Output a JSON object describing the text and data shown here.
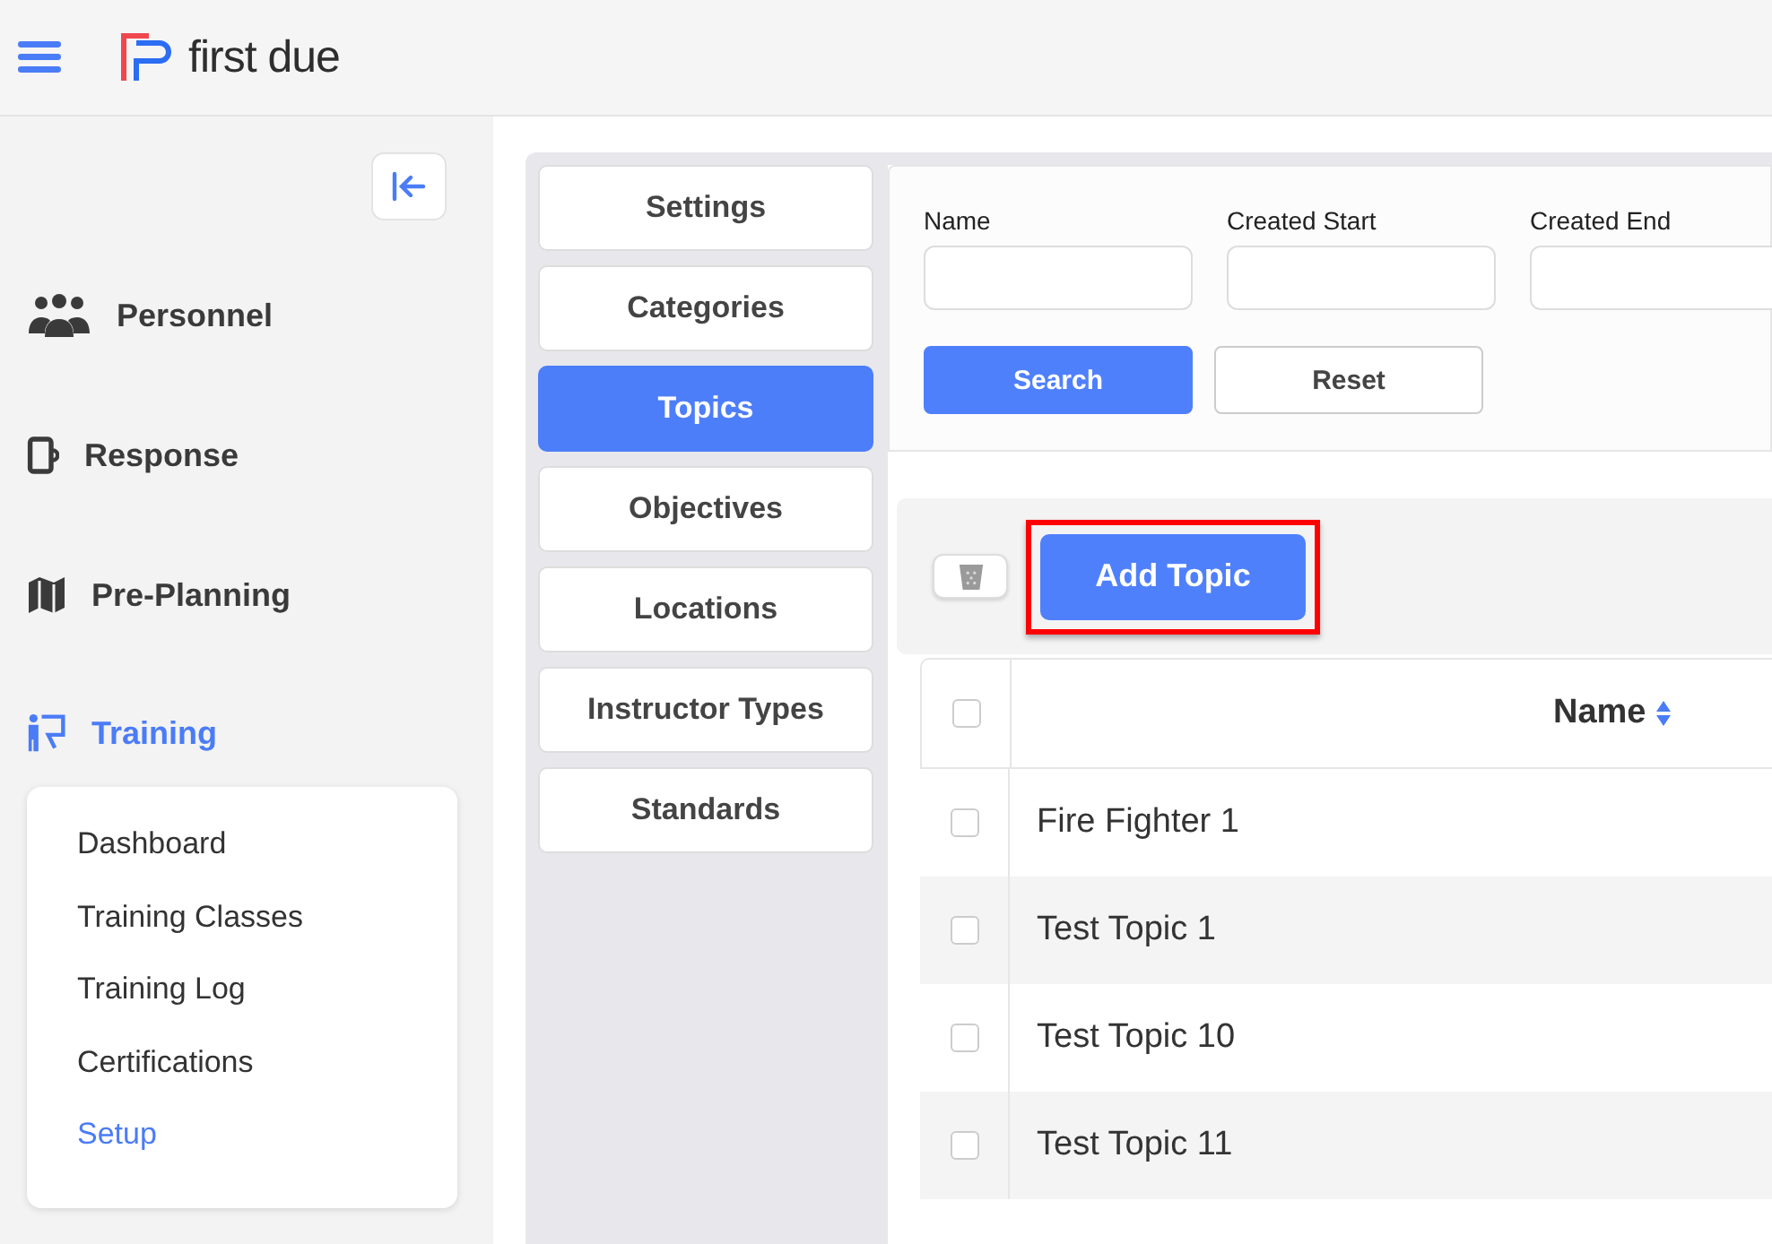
{
  "header": {
    "brand": "first due"
  },
  "sidebar": {
    "items": [
      {
        "label": "Personnel",
        "kind": "people",
        "selected": false
      },
      {
        "label": "Response",
        "kind": "device",
        "selected": false
      },
      {
        "label": "Pre-Planning",
        "kind": "map",
        "selected": false
      },
      {
        "label": "Training",
        "kind": "training",
        "selected": true,
        "children": [
          {
            "label": "Dashboard",
            "selected": false
          },
          {
            "label": "Training Classes",
            "selected": false
          },
          {
            "label": "Training Log",
            "selected": false
          },
          {
            "label": "Certifications",
            "selected": false
          },
          {
            "label": "Setup",
            "selected": true
          }
        ]
      }
    ]
  },
  "setup_tabs": [
    {
      "label": "Settings",
      "selected": false
    },
    {
      "label": "Categories",
      "selected": false
    },
    {
      "label": "Topics",
      "selected": true
    },
    {
      "label": "Objectives",
      "selected": false
    },
    {
      "label": "Locations",
      "selected": false
    },
    {
      "label": "Instructor Types",
      "selected": false
    },
    {
      "label": "Standards",
      "selected": false
    }
  ],
  "filters": {
    "fields": [
      {
        "label": "Name"
      },
      {
        "label": "Created Start"
      },
      {
        "label": "Created End"
      }
    ],
    "search_button": "Search",
    "reset_button": "Reset"
  },
  "toolbar": {
    "add_button": "Add Topic",
    "add_button_highlighted": true
  },
  "table": {
    "columns": [
      {
        "label": "Name",
        "sortable": true
      }
    ],
    "header_checked": false,
    "rows": [
      {
        "name": "Fire Fighter 1",
        "checked": false
      },
      {
        "name": "Test Topic 1",
        "checked": false
      },
      {
        "name": "Test Topic 10",
        "checked": false
      },
      {
        "name": "Test Topic 11",
        "checked": false
      }
    ]
  }
}
